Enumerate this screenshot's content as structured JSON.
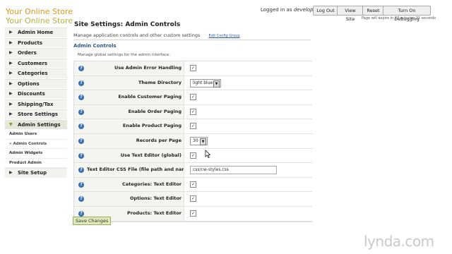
{
  "logo": {
    "line1": "Your Online Store",
    "line2": "Your Online Store"
  },
  "header": {
    "logged_prefix": "Logged in as",
    "username": "developer",
    "buttons": [
      "Log Out",
      "View Site",
      "Reset",
      "Turn On Debugging"
    ],
    "expire_note": "Page will expire in 23 minutes 21 seconds"
  },
  "sidebar": {
    "items": [
      {
        "label": "Admin Home"
      },
      {
        "label": "Products"
      },
      {
        "label": "Orders"
      },
      {
        "label": "Customers"
      },
      {
        "label": "Categories"
      },
      {
        "label": "Options"
      },
      {
        "label": "Discounts"
      },
      {
        "label": "Shipping/Tax"
      },
      {
        "label": "Store Settings"
      },
      {
        "label": "Admin Settings"
      }
    ],
    "subitems": [
      "Admin Users",
      "» Admin Controls",
      "Admin Widgets",
      "Product Admin"
    ],
    "after": {
      "label": "Site Setup"
    }
  },
  "main": {
    "title": "Site Settings: Admin Controls",
    "subtitle": "Manage application controls and other custom settings",
    "edit_link": "Edit Config Group",
    "section_title": "Admin Controls",
    "section_desc": "Manage global settings for the admin interface."
  },
  "settings": [
    {
      "label": "Use Admin Error Handling",
      "type": "checkbox",
      "checked": true
    },
    {
      "label": "Theme Directory",
      "type": "select",
      "value": "light blue"
    },
    {
      "label": "Enable Customer Paging",
      "type": "checkbox",
      "checked": true
    },
    {
      "label": "Enable Order Paging",
      "type": "checkbox",
      "checked": true
    },
    {
      "label": "Enable Product Paging",
      "type": "checkbox",
      "checked": true
    },
    {
      "label": "Records per Page",
      "type": "select",
      "value": "30"
    },
    {
      "label": "Use Text Editor (global)",
      "type": "checkbox",
      "checked": true
    },
    {
      "label": "Text Editor CSS File (file path and name)",
      "type": "text",
      "value": "css/cw-styles.css"
    },
    {
      "label": "Categories: Text Editor",
      "type": "checkbox",
      "checked": true
    },
    {
      "label": "Options: Text Editor",
      "type": "checkbox",
      "checked": true
    },
    {
      "label": "Products: Text Editor",
      "type": "checkbox",
      "checked": true
    }
  ],
  "save_label": "Save Changes",
  "watermark": "lynda.com",
  "icons": {
    "help": "help-icon",
    "arrow": "chevron-right-icon",
    "expanded": "chevron-down-icon"
  }
}
